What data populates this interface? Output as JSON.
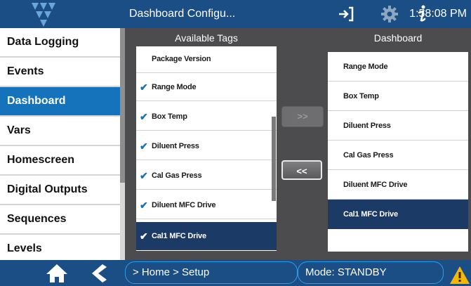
{
  "header": {
    "title": "Dashboard Configu...",
    "clock": "1:58:08 PM",
    "icons": [
      "logo-icon",
      "exit-icon",
      "gear-icon",
      "info-icon"
    ]
  },
  "sidebar": {
    "items": [
      {
        "label": "Data Logging",
        "active": false
      },
      {
        "label": "Events",
        "active": false
      },
      {
        "label": "Dashboard",
        "active": true
      },
      {
        "label": "Vars",
        "active": false
      },
      {
        "label": "Homescreen",
        "active": false
      },
      {
        "label": "Digital Outputs",
        "active": false
      },
      {
        "label": "Sequences",
        "active": false
      },
      {
        "label": "Levels",
        "active": false
      }
    ]
  },
  "available": {
    "title": "Available Tags",
    "items": [
      {
        "label": "Package Version",
        "checked": false,
        "selected": false
      },
      {
        "label": "Range Mode",
        "checked": true,
        "selected": false
      },
      {
        "label": "Box Temp",
        "checked": true,
        "selected": false
      },
      {
        "label": "Diluent Press",
        "checked": true,
        "selected": false
      },
      {
        "label": "Cal Gas Press",
        "checked": true,
        "selected": false
      },
      {
        "label": "Diluent MFC Drive",
        "checked": true,
        "selected": false
      },
      {
        "label": "Cal1 MFC Drive",
        "checked": true,
        "selected": true
      }
    ]
  },
  "dashboard": {
    "title": "Dashboard",
    "items": [
      {
        "label": "Range Mode",
        "selected": false
      },
      {
        "label": "Box Temp",
        "selected": false
      },
      {
        "label": "Diluent Press",
        "selected": false
      },
      {
        "label": "Cal Gas Press",
        "selected": false
      },
      {
        "label": "Diluent MFC Drive",
        "selected": false
      },
      {
        "label": "Cal1 MFC Drive",
        "selected": true
      }
    ]
  },
  "buttons": {
    "add_label": ">>",
    "remove_label": "<<"
  },
  "footer": {
    "breadcrumb": "> Home > Setup",
    "mode": "Mode: STANDBY"
  },
  "colors": {
    "header_bg": "#1c4e86",
    "accent": "#1473bb",
    "selected_row": "#1c3a66",
    "warning": "#f5b800"
  }
}
